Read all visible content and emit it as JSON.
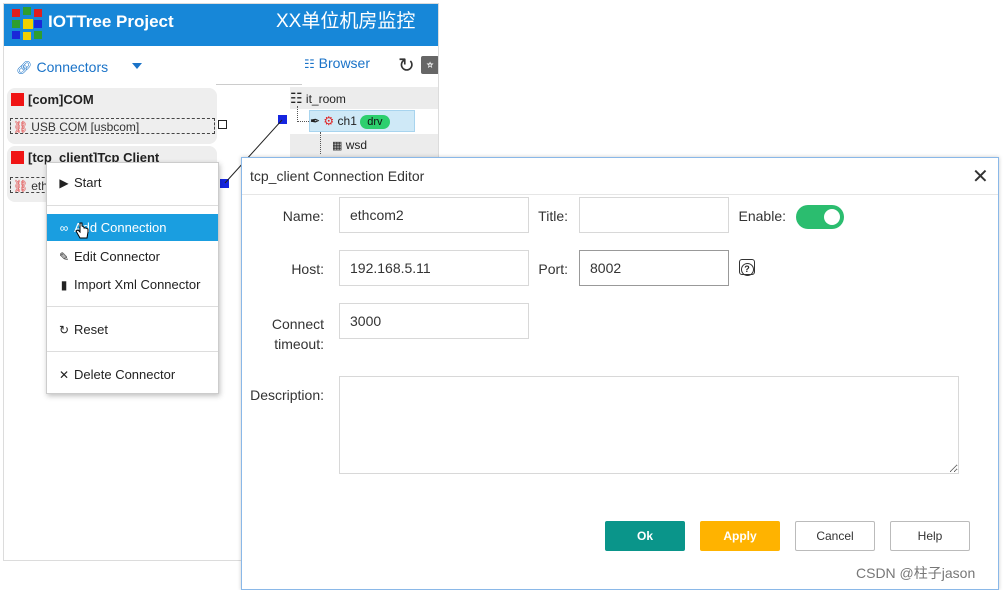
{
  "app": {
    "title": "IOTTree Project",
    "page_title": "XX单位机房监控",
    "brand_colors": [
      "#1787d8",
      "#e01e1e",
      "#2e9e2e",
      "#f2d000",
      "#1a28d8"
    ]
  },
  "tabs": {
    "connectors_label": "Connectors",
    "browser_label": "Browser"
  },
  "connectors": [
    {
      "title": "[com]COM",
      "sub": "USB COM [usbcom]"
    },
    {
      "title": "[tcp_client]Tcp Client",
      "sub": "ethcom2"
    }
  ],
  "tree": {
    "root": "it_room",
    "channel": "ch1",
    "channel_badge": "drv",
    "device": "wsd"
  },
  "context_menu": {
    "items": [
      {
        "label": "Start",
        "icon": "play-icon"
      },
      {
        "label": "Add Connection",
        "icon": "link-icon",
        "active": true
      },
      {
        "label": "Edit Connector",
        "icon": "pencil-icon"
      },
      {
        "label": "Import Xml Connector",
        "icon": "file-icon"
      },
      {
        "label": "Reset",
        "icon": "refresh-icon"
      },
      {
        "label": "Delete Connector",
        "icon": "close-icon"
      }
    ]
  },
  "dialog": {
    "title": "tcp_client Connection Editor",
    "name_label": "Name:",
    "name_value": "ethcom2",
    "title_label": "Title:",
    "title_value": "",
    "enable_label": "Enable:",
    "enable_on": true,
    "host_label": "Host:",
    "host_value": "192.168.5.11",
    "port_label": "Port:",
    "port_value": "8002",
    "timeout_label_1": "Connect",
    "timeout_label_2": "timeout:",
    "timeout_value": "3000",
    "description_label": "Description:",
    "description_value": "",
    "buttons": {
      "ok": "Ok",
      "apply": "Apply",
      "cancel": "Cancel",
      "help": "Help"
    }
  },
  "watermark": "CSDN @柱子jason"
}
